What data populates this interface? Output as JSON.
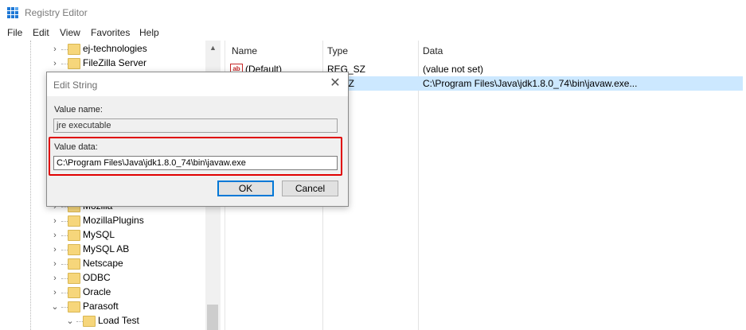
{
  "window": {
    "title": "Registry Editor",
    "icon": "registry-editor-icon"
  },
  "menubar": [
    {
      "label": "File"
    },
    {
      "label": "Edit"
    },
    {
      "label": "View"
    },
    {
      "label": "Favorites"
    },
    {
      "label": "Help"
    }
  ],
  "tree": {
    "top_items": [
      {
        "label": "ej-technologies",
        "expanded": false
      },
      {
        "label": "FileZilla Server",
        "expanded": false
      }
    ],
    "bottom_items": [
      {
        "label": "Mozilla",
        "expanded": false
      },
      {
        "label": "MozillaPlugins",
        "expanded": false
      },
      {
        "label": "MySQL",
        "expanded": false
      },
      {
        "label": "MySQL AB",
        "expanded": false
      },
      {
        "label": "Netscape",
        "expanded": false
      },
      {
        "label": "ODBC",
        "expanded": false
      },
      {
        "label": "Oracle",
        "expanded": false
      },
      {
        "label": "Parasoft",
        "expanded": true
      },
      {
        "label": "Load Test",
        "expanded": true
      }
    ]
  },
  "list": {
    "columns": {
      "name": "Name",
      "type": "Type",
      "data": "Data"
    },
    "rows": [
      {
        "name": "(Default)",
        "type": "REG_SZ",
        "data": "(value not set)",
        "selected": false
      },
      {
        "name": "",
        "type": "REG_SZ",
        "type_visible": "_SZ",
        "data": "C:\\Program Files\\Java\\jdk1.8.0_74\\bin\\javaw.exe...",
        "selected": true
      }
    ]
  },
  "dialog": {
    "title": "Edit String",
    "value_name_label": "Value name:",
    "value_name": "jre executable",
    "value_data_label": "Value data:",
    "value_data": "C:\\Program Files\\Java\\jdk1.8.0_74\\bin\\javaw.exe",
    "ok_label": "OK",
    "cancel_label": "Cancel",
    "close_glyph": "✕"
  },
  "colors": {
    "selection": "#cce8ff",
    "highlight_box": "#e00000",
    "folder": "#f6d67b"
  }
}
